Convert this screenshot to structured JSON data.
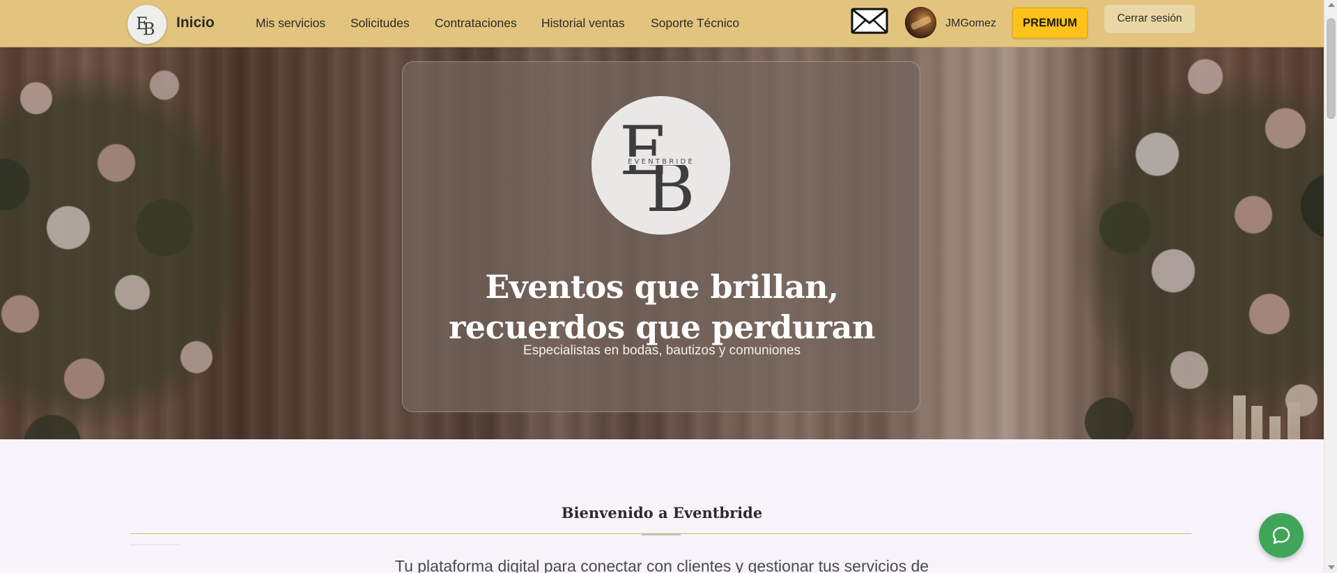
{
  "nav": {
    "home_label": "Inicio",
    "items": [
      {
        "label": "Mis servicios"
      },
      {
        "label": "Solicitudes"
      },
      {
        "label": "Contrataciones"
      },
      {
        "label": "Historial ventas"
      },
      {
        "label": "Soporte Técnico"
      }
    ],
    "username": "JMGomez",
    "premium_label": "PREMIUM",
    "logout_label": "Cerrar sesión",
    "mail_icon": "mail-envelope-icon",
    "avatar_icon": "user-avatar"
  },
  "hero": {
    "logo_text": "EVENTBRIDE",
    "logo_monogram": "EB",
    "title_line1": "Eventos que brillan,",
    "title_line2": "recuerdos que perduran",
    "subtitle": "Especialistas en bodas, bautizos y comuniones"
  },
  "welcome": {
    "title": "Bienvenido a Eventbride",
    "text": "Tu plataforma digital para conectar con clientes y gestionar tus servicios de"
  },
  "chat": {
    "icon": "chat-bubble-icon"
  },
  "colors": {
    "topbar": "#e2c47f",
    "premium": "#ffc21a",
    "logout": "#ead7a6",
    "chat": "#3fa659",
    "gold_rule": "#d3b569",
    "page_bg": "#f7f4fc"
  }
}
